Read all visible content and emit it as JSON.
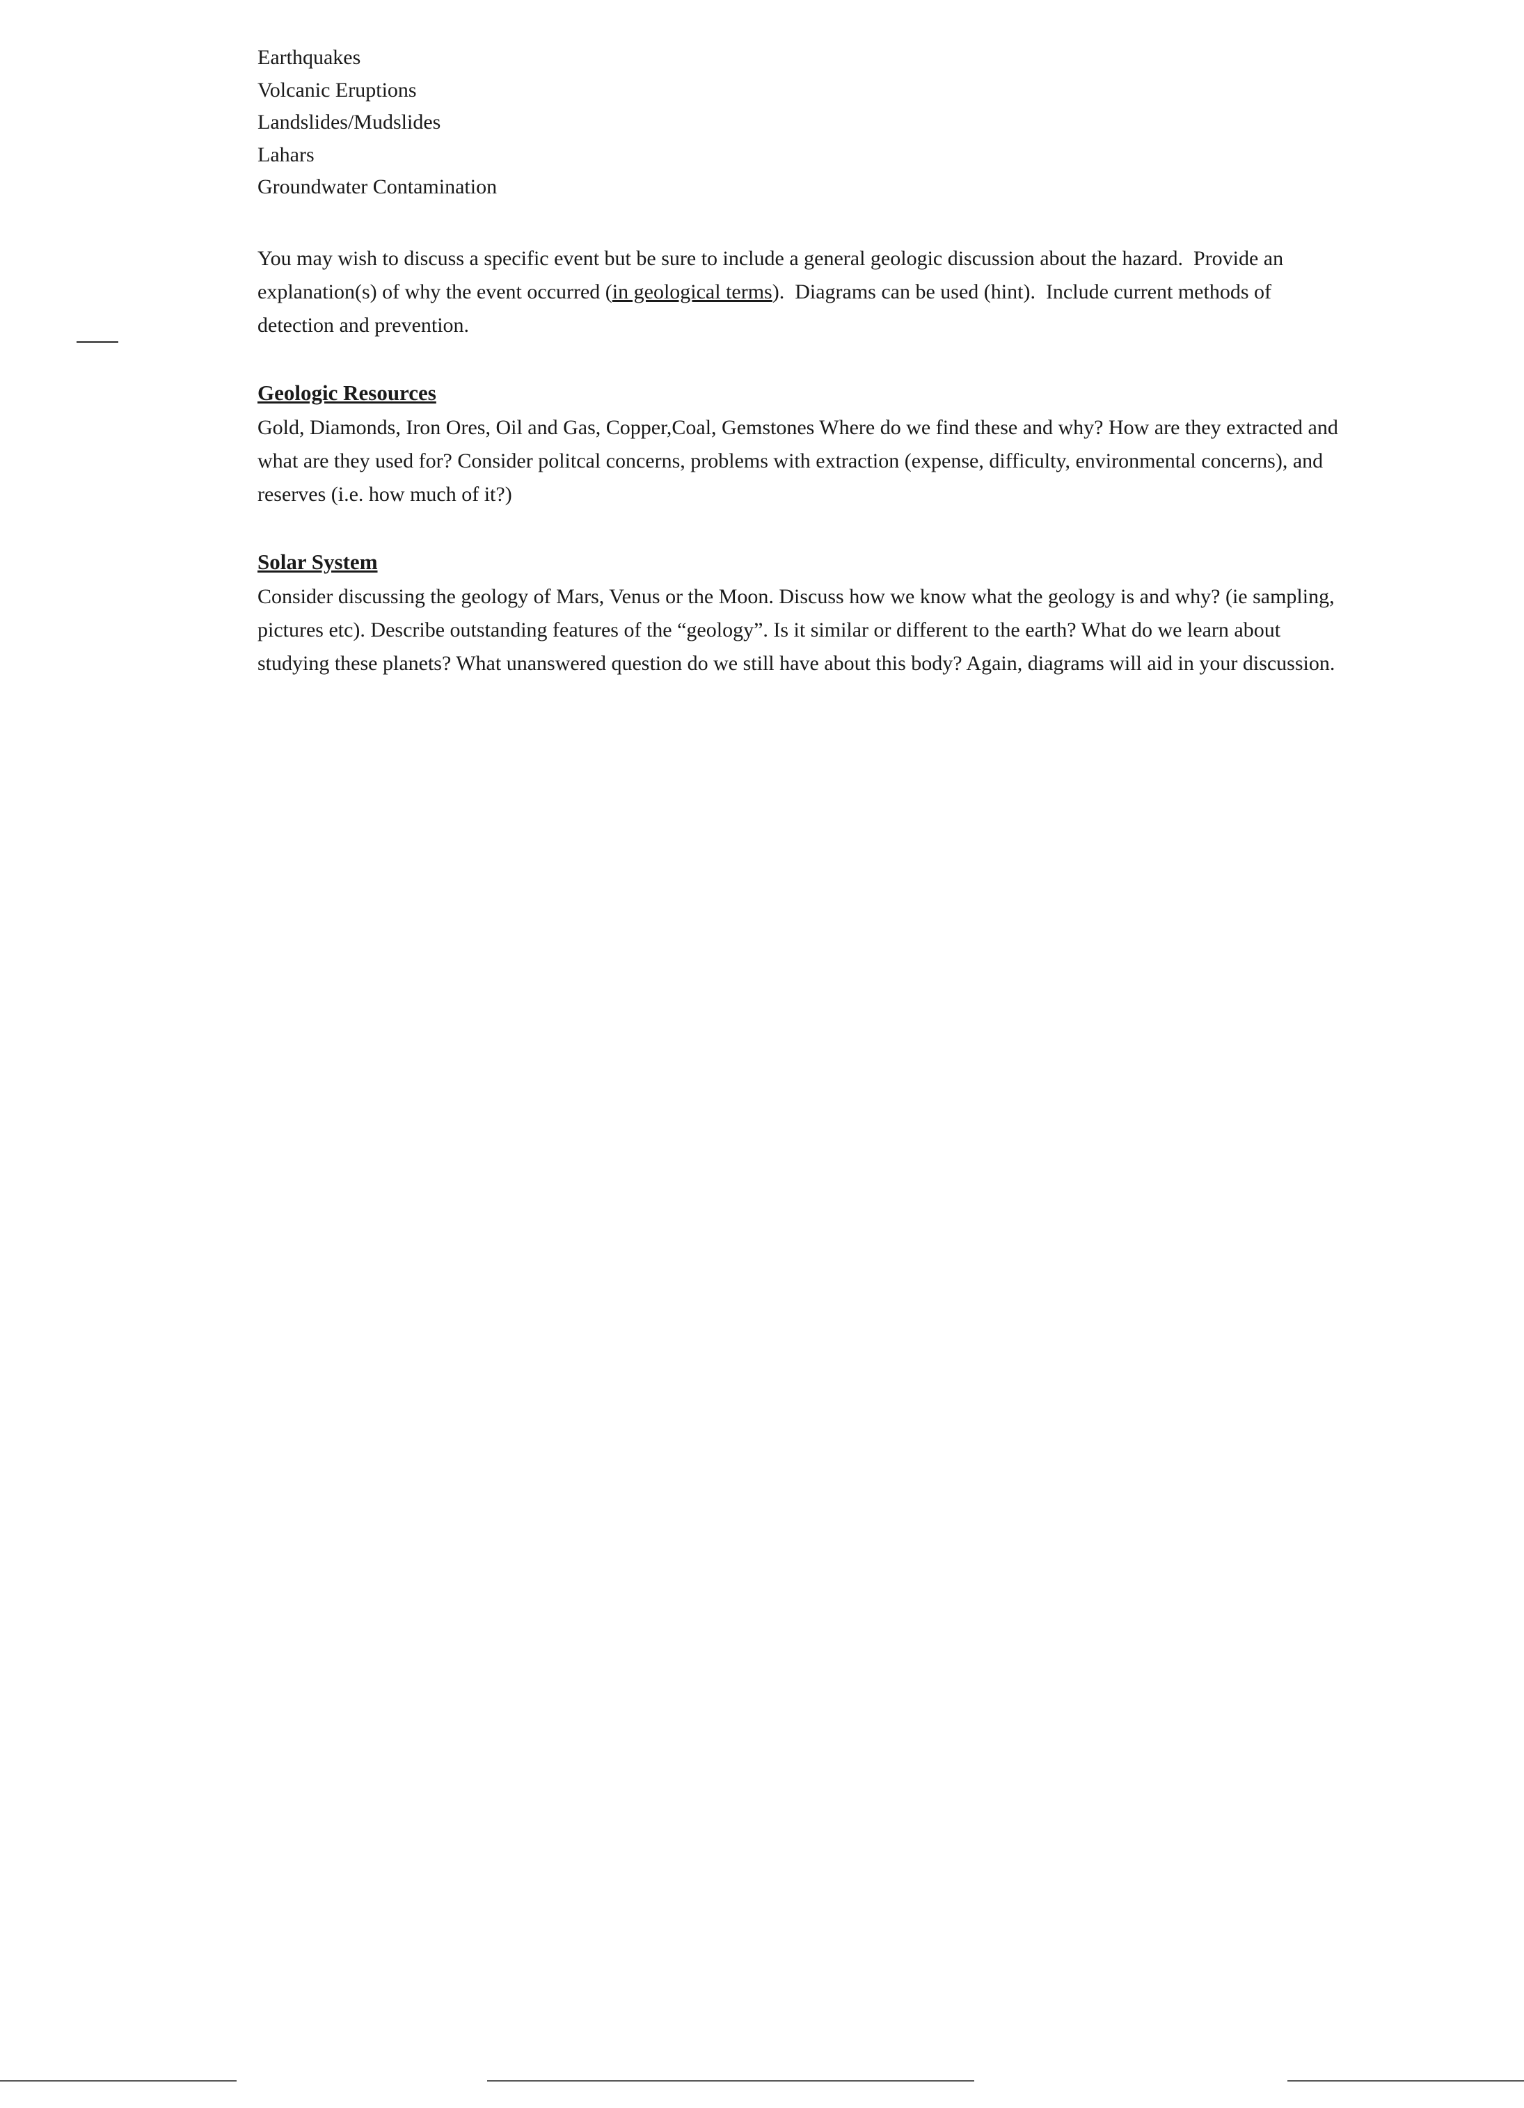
{
  "list": {
    "items": [
      "Earthquakes",
      "Volcanic Eruptions",
      "Landslides/Mudslides",
      "Lahars",
      "Groundwater Contamination"
    ]
  },
  "intro_paragraph": {
    "text": "You may wish to discuss a specific event but be sure to include a general geologic discussion about the hazard.  Provide an explanation(s) of why the event occurred (in geological terms).  Diagrams can be used (hint).  Include current methods of detection and prevention.",
    "underline_phrase": "in geological terms"
  },
  "geologic_resources": {
    "heading": "Geologic Resources",
    "body": "Gold, Diamonds, Iron Ores, Oil and Gas, Copper,Coal, Gemstones Where do we find these and why?  How are they extracted and what are they used for?  Consider politcal concerns, problems with extraction (expense, difficulty, environmental concerns), and reserves (i.e. how much of it?)"
  },
  "solar_system": {
    "heading": "Solar System",
    "body": "Consider discussing the geology of Mars, Venus or the Moon. Discuss how we know what the geology is and why? (ie sampling, pictures etc).  Describe outstanding features of the “geology”.  Is it similar or different to the earth?  What do we learn about studying these planets?  What unanswered question do we still have about this body?  Again, diagrams will aid in your discussion."
  }
}
